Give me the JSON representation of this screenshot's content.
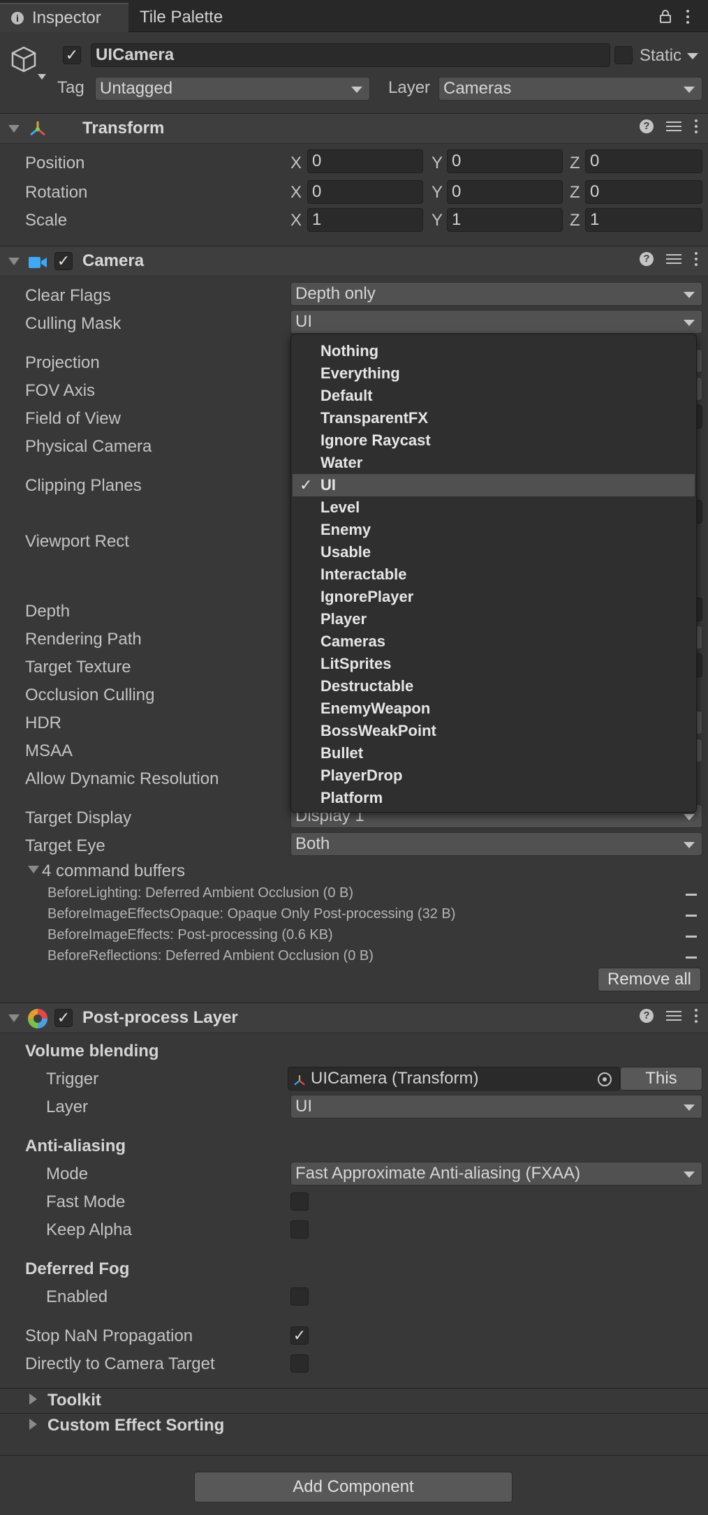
{
  "tabs": [
    {
      "label": "Inspector"
    },
    {
      "label": "Tile Palette"
    }
  ],
  "object": {
    "name": "UICamera",
    "static_label": "Static",
    "tag_label": "Tag",
    "tag_value": "Untagged",
    "layer_label": "Layer",
    "layer_value": "Cameras"
  },
  "transform": {
    "title": "Transform",
    "rows": [
      {
        "label": "Position",
        "x": "0",
        "y": "0",
        "z": "0"
      },
      {
        "label": "Rotation",
        "x": "0",
        "y": "0",
        "z": "0"
      },
      {
        "label": "Scale",
        "x": "1",
        "y": "1",
        "z": "1"
      }
    ],
    "axis": {
      "x": "X",
      "y": "Y",
      "z": "Z"
    }
  },
  "camera": {
    "title": "Camera",
    "labels": [
      "Clear Flags",
      "Culling Mask",
      "Projection",
      "FOV Axis",
      "Field of View",
      "Physical Camera",
      "Clipping Planes",
      "Viewport Rect",
      "Depth",
      "Rendering Path",
      "Target Texture",
      "Occlusion Culling",
      "HDR",
      "MSAA",
      "Allow Dynamic Resolution",
      "Target Display",
      "Target Eye"
    ],
    "clear_flags": "Depth only",
    "culling_mask": "UI",
    "target_display": "Display 1",
    "target_eye": "Both",
    "command_buffers_title": "4 command buffers",
    "command_buffers": [
      "BeforeLighting: Deferred Ambient Occlusion (0 B)",
      "BeforeImageEffectsOpaque: Opaque Only Post-processing (32 B)",
      "BeforeImageEffects: Post-processing (0.6 KB)",
      "BeforeReflections: Deferred Ambient Occlusion (0 B)"
    ],
    "remove_all": "Remove all"
  },
  "culling_menu": {
    "options": [
      "Nothing",
      "Everything",
      "Default",
      "TransparentFX",
      "Ignore Raycast",
      "Water",
      "UI",
      "Level",
      "Enemy",
      "Usable",
      "Interactable",
      "IgnorePlayer",
      "Player",
      "Cameras",
      "LitSprites",
      "Destructable",
      "EnemyWeapon",
      "BossWeakPoint",
      "Bullet",
      "PlayerDrop",
      "Platform"
    ],
    "selected": "UI",
    "check": "✓"
  },
  "postprocess": {
    "title": "Post-process Layer",
    "volume_blending": "Volume blending",
    "trigger_label": "Trigger",
    "trigger_value": "UICamera (Transform)",
    "this_button": "This",
    "layer_label": "Layer",
    "layer_value": "UI",
    "anti_aliasing": "Anti-aliasing",
    "mode_label": "Mode",
    "mode_value": "Fast Approximate Anti-aliasing (FXAA)",
    "fast_mode": "Fast Mode",
    "keep_alpha": "Keep Alpha",
    "deferred_fog": "Deferred Fog",
    "enabled": "Enabled",
    "stop_nan": "Stop NaN Propagation",
    "directly_to_camera": "Directly to Camera Target",
    "toolkit": "Toolkit",
    "custom_effect_sorting": "Custom Effect Sorting"
  },
  "add_component": "Add Component",
  "colors": {
    "background": "#383838",
    "header": "#3e3e3e",
    "field": "#2a2a2a",
    "dropdown": "#515151",
    "menu": "#2f2f2f",
    "menu_selected": "#505050"
  }
}
